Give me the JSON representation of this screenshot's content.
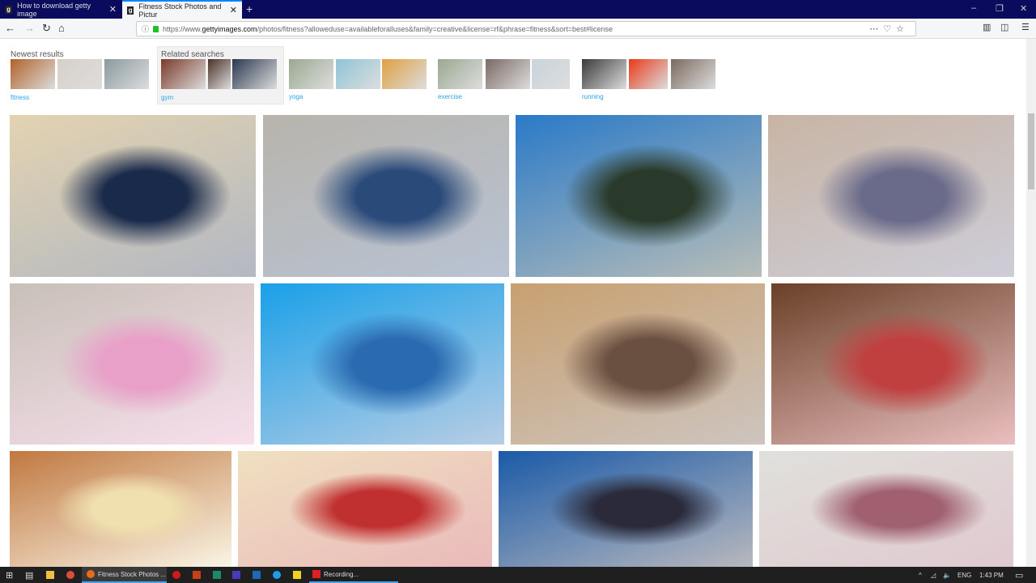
{
  "browser": {
    "tabs": [
      {
        "label": "How to download getty image",
        "favicon": "g"
      },
      {
        "label": "Fitness Stock Photos and Pictur",
        "favicon": "g"
      }
    ],
    "url_prefix": "https://www.",
    "url_domain": "gettyimages.com",
    "url_rest": "/photos/fitness?alloweduse=availableforalluses&family=creative&license=rf&phrase=fitness&sort=best#license",
    "icons": [
      "back-icon",
      "forward-icon",
      "reload-icon",
      "home-icon",
      "info-icon",
      "lock-icon",
      "more-icon",
      "pocket-icon",
      "bookmark-star-icon",
      "library-icon",
      "sidebar-icon",
      "menu-icon"
    ]
  },
  "searches": {
    "newest_label": "Newest results",
    "related_label": "Related searches",
    "groups": [
      {
        "link": "fitness",
        "colors": [
          "#b0622a",
          "#d8d0c8",
          "#8a9aa0"
        ]
      },
      {
        "link": "gym",
        "colors": [
          "#7a3a2a",
          "#4a3028",
          "#2a3850"
        ]
      },
      {
        "link": "yoga",
        "colors": [
          "#9aa890",
          "#8fc4d8",
          "#e0a040"
        ]
      },
      {
        "link": "exercise",
        "colors": [
          "#9aa890",
          "#7a6a64",
          "#c8d4dc"
        ]
      },
      {
        "link": "running",
        "colors": [
          "#3a3a3a",
          "#e83a1a",
          "#7a6a60"
        ]
      }
    ]
  },
  "photos": [
    [
      "#e3d3b0",
      "#1a2a4a"
    ],
    [
      "#b8b4ac",
      "#2a4a7a"
    ],
    [
      "#2a7ac8",
      "#2a3a2a"
    ],
    [
      "#c8b4a4",
      "#6a6a8a"
    ],
    [
      "#c8c0b8",
      "#e8a0c8"
    ],
    [
      "#1aa0e8",
      "#2a6ab0"
    ],
    [
      "#c8a070",
      "#6a5040"
    ],
    [
      "#6a4028",
      "#c04040"
    ],
    [
      "#c07840",
      "#f0e0b0"
    ],
    [
      "#f0e0c0",
      "#c03030"
    ],
    [
      "#1a5aa8",
      "#2a2a3a"
    ],
    [
      "#e0e0dc",
      "#a06070"
    ]
  ],
  "taskbar": {
    "app1": "Fitness Stock Photos ...",
    "app2": "Recording...",
    "lang": "ENG",
    "time": "1:43 PM"
  }
}
